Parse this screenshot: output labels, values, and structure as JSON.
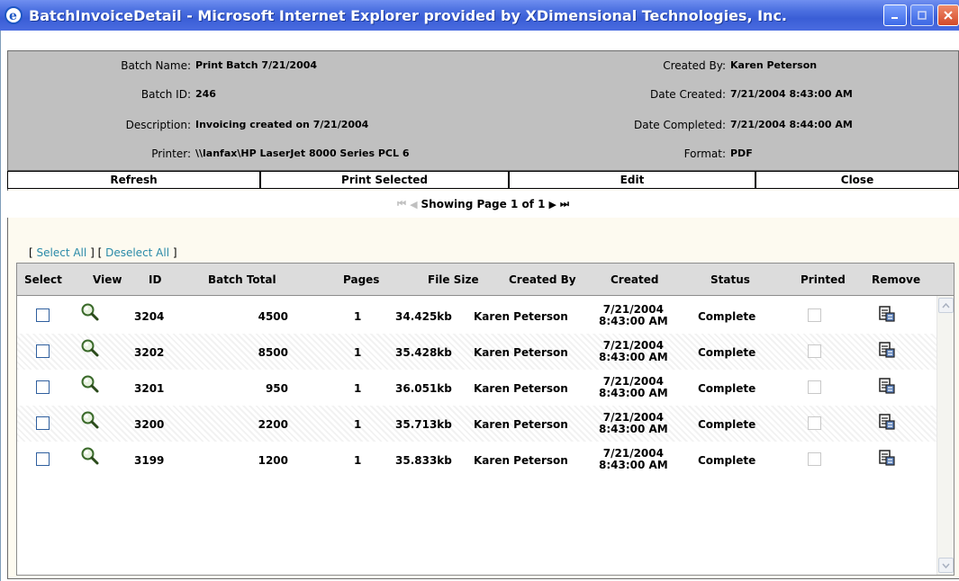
{
  "window": {
    "title": "BatchInvoiceDetail - Microsoft Internet Explorer provided by XDimensional Technologies, Inc."
  },
  "info": {
    "batch_name_label": "Batch Name:",
    "batch_name": "Print Batch 7/21/2004",
    "batch_id_label": "Batch ID:",
    "batch_id": "246",
    "description_label": "Description:",
    "description": "Invoicing created on 7/21/2004",
    "printer_label": "Printer:",
    "printer": "\\\\lanfax\\HP LaserJet 8000 Series PCL 6",
    "created_by_label": "Created By:",
    "created_by": "Karen Peterson",
    "date_created_label": "Date Created:",
    "date_created": "7/21/2004 8:43:00 AM",
    "date_completed_label": "Date Completed:",
    "date_completed": "7/21/2004 8:44:00 AM",
    "format_label": "Format:",
    "format": "PDF"
  },
  "actions": {
    "refresh": "Refresh",
    "print_selected": "Print Selected",
    "edit": "Edit",
    "close": "Close"
  },
  "pager": {
    "text": "Showing Page 1 of 1"
  },
  "selection": {
    "open1": "[",
    "select_all": "Select All",
    "close1": "]",
    "open2": "[",
    "deselect_all": "Deselect All",
    "close2": "]"
  },
  "grid": {
    "columns": {
      "select": "Select",
      "view": "View",
      "id": "ID",
      "batch_total": "Batch Total",
      "pages": "Pages",
      "file_size": "File Size",
      "created_by": "Created By",
      "created": "Created",
      "status": "Status",
      "printed": "Printed",
      "remove": "Remove"
    },
    "rows": [
      {
        "id": "3204",
        "batch_total": "4500",
        "pages": "1",
        "file_size": "34.425kb",
        "created_by": "Karen Peterson",
        "created_date": "7/21/2004",
        "created_time": "8:43:00 AM",
        "status": "Complete"
      },
      {
        "id": "3202",
        "batch_total": "8500",
        "pages": "1",
        "file_size": "35.428kb",
        "created_by": "Karen Peterson",
        "created_date": "7/21/2004",
        "created_time": "8:43:00 AM",
        "status": "Complete"
      },
      {
        "id": "3201",
        "batch_total": "950",
        "pages": "1",
        "file_size": "36.051kb",
        "created_by": "Karen Peterson",
        "created_date": "7/21/2004",
        "created_time": "8:43:00 AM",
        "status": "Complete"
      },
      {
        "id": "3200",
        "batch_total": "2200",
        "pages": "1",
        "file_size": "35.713kb",
        "created_by": "Karen Peterson",
        "created_date": "7/21/2004",
        "created_time": "8:43:00 AM",
        "status": "Complete"
      },
      {
        "id": "3199",
        "batch_total": "1200",
        "pages": "1",
        "file_size": "35.833kb",
        "created_by": "Karen Peterson",
        "created_date": "7/21/2004",
        "created_time": "8:43:00 AM",
        "status": "Complete"
      }
    ]
  },
  "icons": {
    "view": "magnifier-icon",
    "remove": "remove-document-icon",
    "app": "internet-explorer-icon"
  }
}
